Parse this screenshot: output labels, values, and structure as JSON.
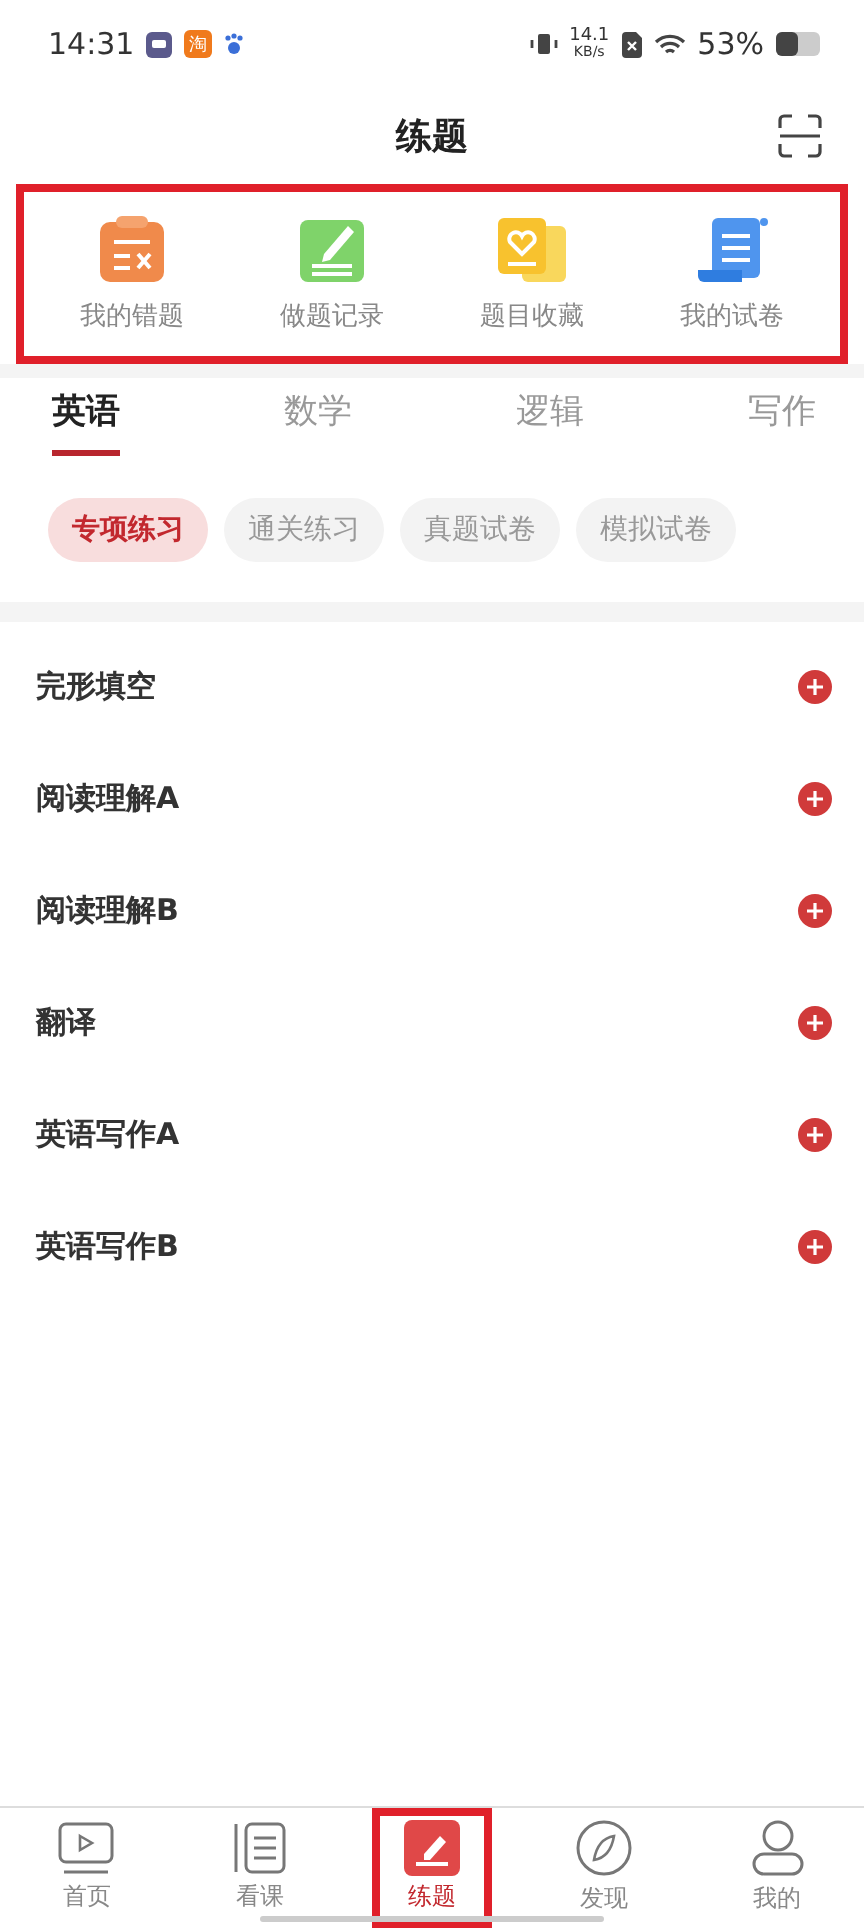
{
  "status_bar": {
    "time": "14:31",
    "app_badge": "淘",
    "speed_value": "14.1",
    "speed_unit": "KB/s",
    "battery": "53%"
  },
  "header": {
    "title": "练题"
  },
  "shortcuts": {
    "highlighted": true,
    "items": [
      {
        "kind": "mistakes",
        "label": "我的错题"
      },
      {
        "kind": "records",
        "label": "做题记录"
      },
      {
        "kind": "favorites",
        "label": "题目收藏"
      },
      {
        "kind": "papers",
        "label": "我的试卷"
      }
    ]
  },
  "subject_tabs": [
    {
      "label": "英语",
      "selected": true
    },
    {
      "label": "数学",
      "selected": false
    },
    {
      "label": "逻辑",
      "selected": false
    },
    {
      "label": "写作",
      "selected": false
    }
  ],
  "practice_chips": [
    {
      "label": "专项练习",
      "selected": true
    },
    {
      "label": "通关练习",
      "selected": false
    },
    {
      "label": "真题试卷",
      "selected": false
    },
    {
      "label": "模拟试卷",
      "selected": false
    }
  ],
  "topics": [
    {
      "label": "完形填空"
    },
    {
      "label": "阅读理解A"
    },
    {
      "label": "阅读理解B"
    },
    {
      "label": "翻译"
    },
    {
      "label": "英语写作A"
    },
    {
      "label": "英语写作B"
    }
  ],
  "bottom_nav": [
    {
      "kind": "home",
      "label": "首页",
      "selected": false,
      "highlighted": false
    },
    {
      "kind": "courses",
      "label": "看课",
      "selected": false,
      "highlighted": false
    },
    {
      "kind": "practice",
      "label": "练题",
      "selected": true,
      "highlighted": true
    },
    {
      "kind": "discover",
      "label": "发现",
      "selected": false,
      "highlighted": false
    },
    {
      "kind": "profile",
      "label": "我的",
      "selected": false,
      "highlighted": false
    }
  ]
}
